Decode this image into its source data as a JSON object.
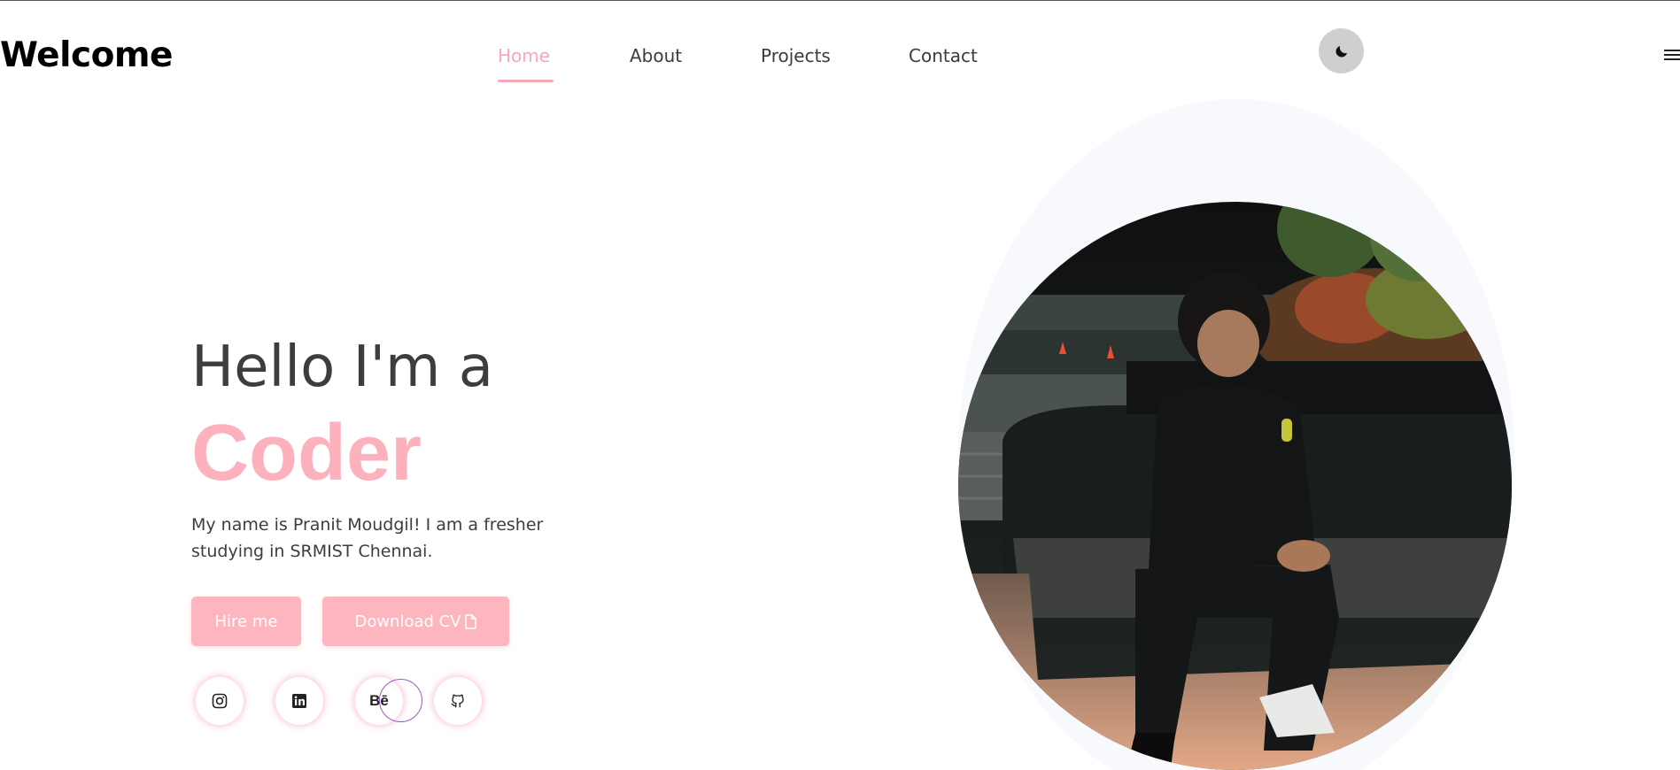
{
  "header": {
    "brand": "Welcome",
    "nav": [
      {
        "label": "Home",
        "active": true
      },
      {
        "label": "About",
        "active": false
      },
      {
        "label": "Projects",
        "active": false
      },
      {
        "label": "Contact",
        "active": false
      }
    ],
    "theme_toggle_icon": "moon-icon",
    "menu_icon": "hamburger-icon"
  },
  "hero": {
    "greeting": "Hello I'm a",
    "role": "Coder",
    "intro": "My name is Pranit Moudgil! I am a fresher studying in SRMIST Chennai.",
    "buttons": {
      "hire": "Hire me",
      "cv": "Download CV"
    },
    "social": [
      {
        "icon": "instagram-icon"
      },
      {
        "icon": "linkedin-icon"
      },
      {
        "icon": "behance-icon",
        "label": "Bē"
      },
      {
        "icon": "github-icon"
      }
    ]
  },
  "colors": {
    "accent": "#fdb1bd",
    "text": "#3d3d3d",
    "toggle_bg": "#cfcfcf",
    "blob_bg": "#f8f9fd"
  }
}
